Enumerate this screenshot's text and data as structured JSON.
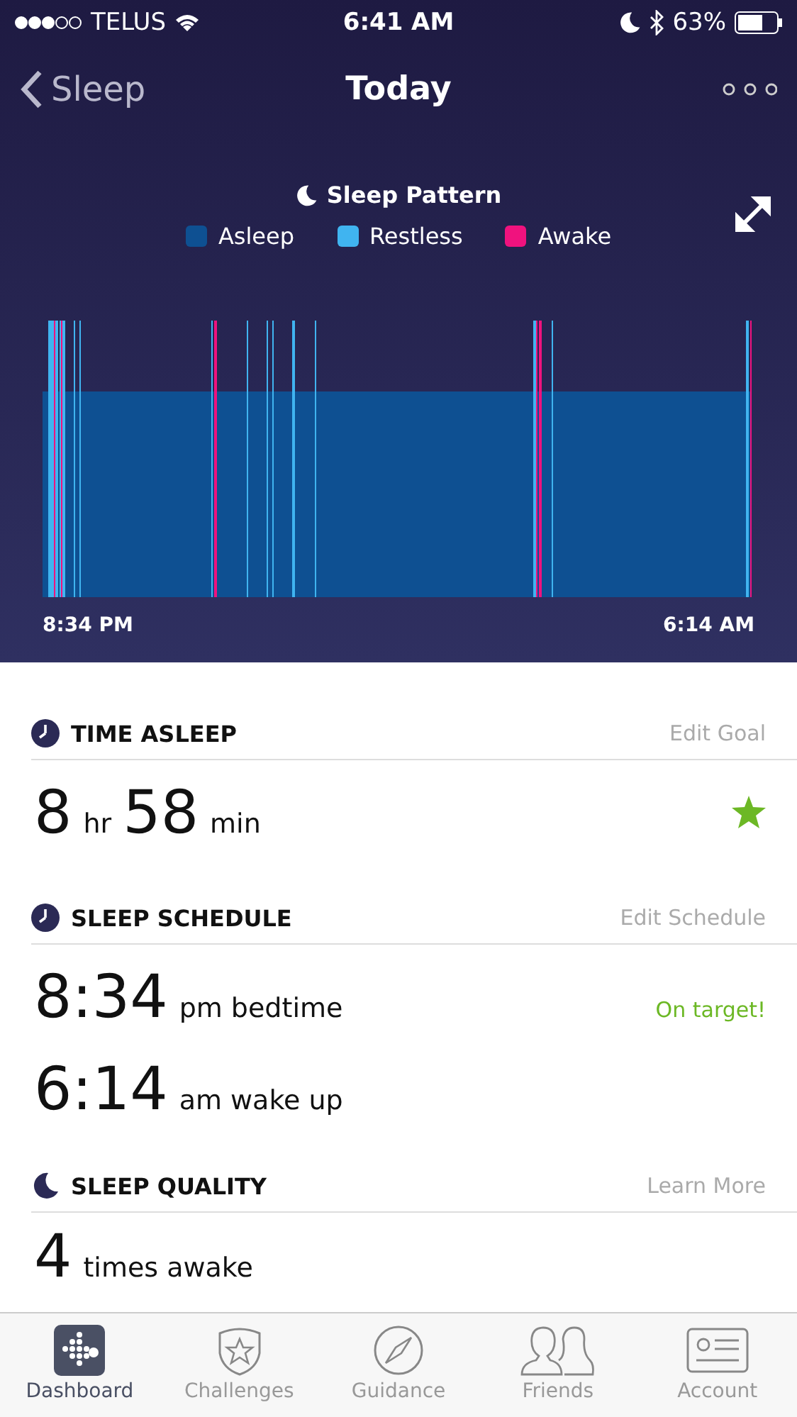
{
  "status_bar": {
    "carrier": "TELUS",
    "time": "6:41 AM",
    "battery": "63%"
  },
  "nav": {
    "back": "Sleep",
    "title": "Today"
  },
  "chart": {
    "title": "Sleep Pattern",
    "legend": [
      {
        "label": "Asleep",
        "color": "#0e5092"
      },
      {
        "label": "Restless",
        "color": "#40b4f0"
      },
      {
        "label": "Awake",
        "color": "#f0127e"
      }
    ],
    "start": "8:34 PM",
    "end": "6:14 AM"
  },
  "time_asleep": {
    "kind": "clock",
    "heading": "TIME ASLEEP",
    "action": "Edit Goal",
    "parts": [
      {
        "text": "8",
        "kind": "number"
      },
      {
        "text": "hr",
        "kind": "unit"
      },
      {
        "text": "58",
        "kind": "number"
      },
      {
        "text": "min",
        "kind": "unit"
      }
    ],
    "goal_met": true
  },
  "sleep_schedule": {
    "kind": "clock",
    "heading": "SLEEP SCHEDULE",
    "action": "Edit Schedule",
    "rows": [
      {
        "value": "8:34",
        "label": "pm bedtime",
        "note": "On target!"
      },
      {
        "value": "6:14",
        "label": "am wake up"
      }
    ]
  },
  "sleep_quality": {
    "kind": "moon",
    "heading": "SLEEP QUALITY",
    "action": "Learn More",
    "value": "4",
    "label": "times awake"
  },
  "tabs": [
    {
      "label": "Dashboard",
      "kind": "dashboard",
      "selected": true
    },
    {
      "label": "Challenges",
      "kind": "badge",
      "selected": false
    },
    {
      "label": "Guidance",
      "kind": "compass",
      "selected": false
    },
    {
      "label": "Friends",
      "kind": "friends",
      "selected": false
    },
    {
      "label": "Account",
      "kind": "card",
      "selected": false
    }
  ]
}
